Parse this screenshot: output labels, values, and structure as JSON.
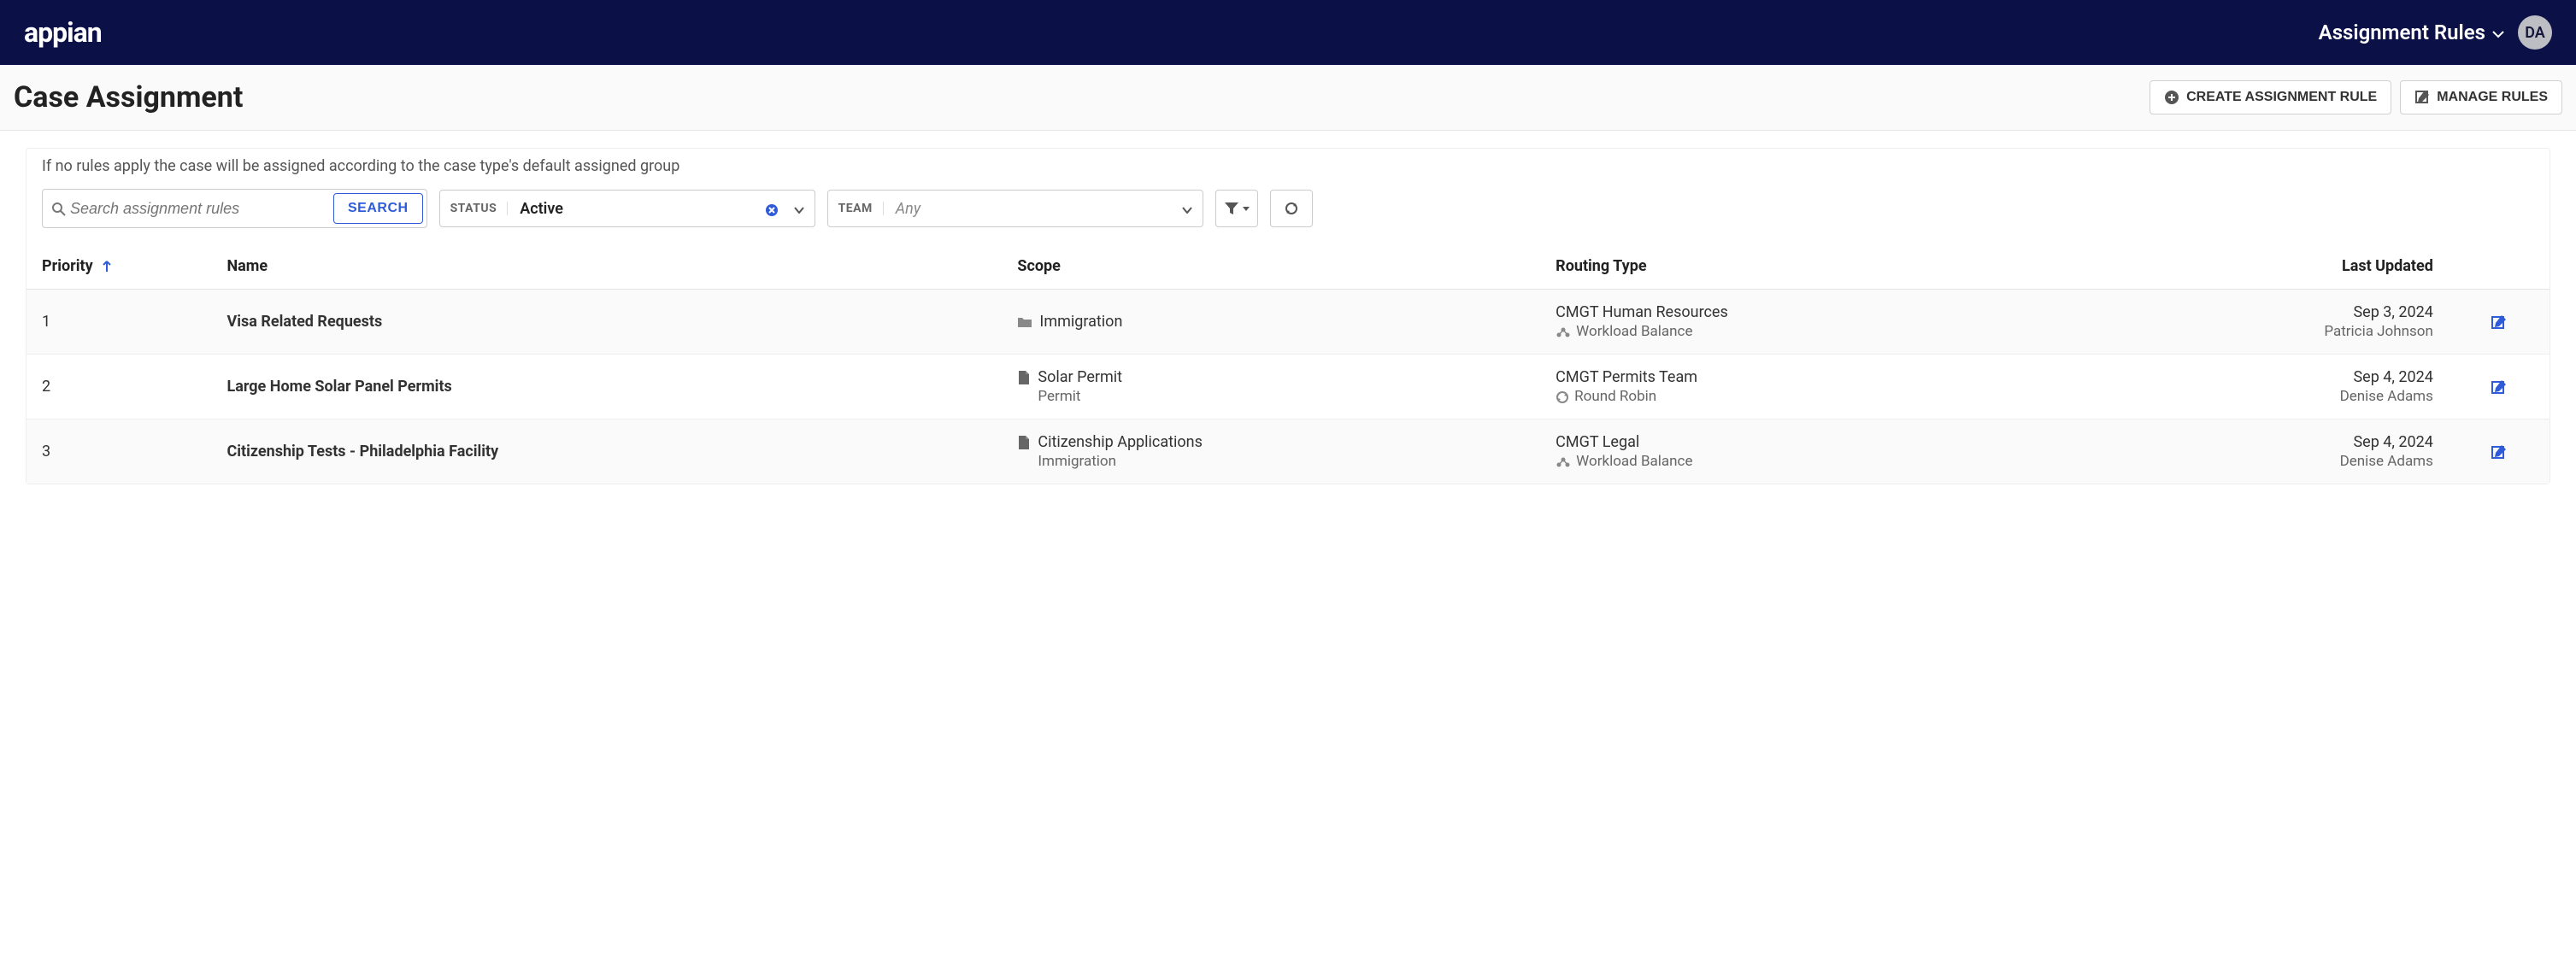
{
  "header": {
    "brand": "appian",
    "nav_title": "Assignment Rules",
    "avatar_initials": "DA"
  },
  "page": {
    "title": "Case Assignment",
    "create_button": "CREATE ASSIGNMENT RULE",
    "manage_button": "MANAGE RULES",
    "hint": "If no rules apply the case will be assigned according to the case type's default assigned group"
  },
  "filters": {
    "search_placeholder": "Search assignment rules",
    "search_button": "SEARCH",
    "status_label": "STATUS",
    "status_value": "Active",
    "team_label": "TEAM",
    "team_placeholder": "Any"
  },
  "columns": {
    "priority": "Priority",
    "name": "Name",
    "scope": "Scope",
    "routing": "Routing Type",
    "updated": "Last Updated"
  },
  "rows": [
    {
      "priority": "1",
      "name": "Visa Related Requests",
      "scope_icon": "folder",
      "scope_title": "Immigration",
      "scope_sub": "",
      "routing_team": "CMGT Human Resources",
      "routing_type_icon": "balance",
      "routing_type": "Workload Balance",
      "updated_date": "Sep 3, 2024",
      "updated_by": "Patricia Johnson"
    },
    {
      "priority": "2",
      "name": "Large Home Solar Panel Permits",
      "scope_icon": "file",
      "scope_title": "Solar Permit",
      "scope_sub": "Permit",
      "routing_team": "CMGT Permits Team",
      "routing_type_icon": "roundrobin",
      "routing_type": "Round Robin",
      "updated_date": "Sep 4, 2024",
      "updated_by": "Denise Adams"
    },
    {
      "priority": "3",
      "name": "Citizenship Tests - Philadelphia Facility",
      "scope_icon": "file",
      "scope_title": "Citizenship Applications",
      "scope_sub": "Immigration",
      "routing_team": "CMGT Legal",
      "routing_type_icon": "balance",
      "routing_type": "Workload Balance",
      "updated_date": "Sep 4, 2024",
      "updated_by": "Denise Adams"
    }
  ]
}
